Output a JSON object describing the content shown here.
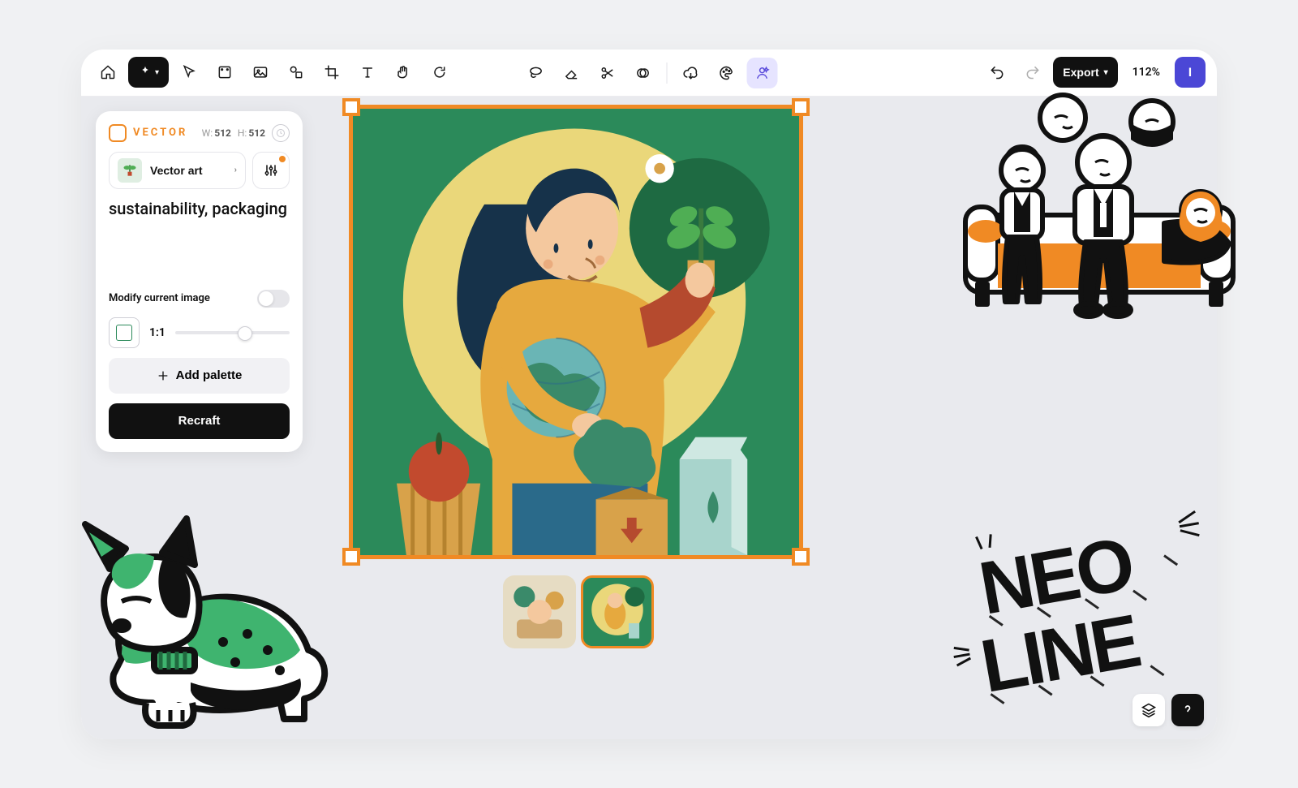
{
  "toolbar": {
    "export_label": "Export",
    "zoom_label": "112%",
    "avatar_initial": "I"
  },
  "panel": {
    "brand": "VECTOR",
    "width_label": "W:",
    "width_value": "512",
    "height_label": "H:",
    "height_value": "512",
    "style_label": "Vector art",
    "prompt_value": "sustainability, packaging",
    "modify_label": "Modify current image",
    "modify_on": false,
    "aspect_ratio_label": "1:1",
    "add_palette_label": "Add palette",
    "recraft_label": "Recraft"
  },
  "canvas": {
    "variants": [
      {
        "id": "variant-1",
        "selected": false
      },
      {
        "id": "variant-2",
        "selected": true
      }
    ]
  },
  "decor": {
    "neo_top": "NEO",
    "neo_bottom": "LINE"
  }
}
